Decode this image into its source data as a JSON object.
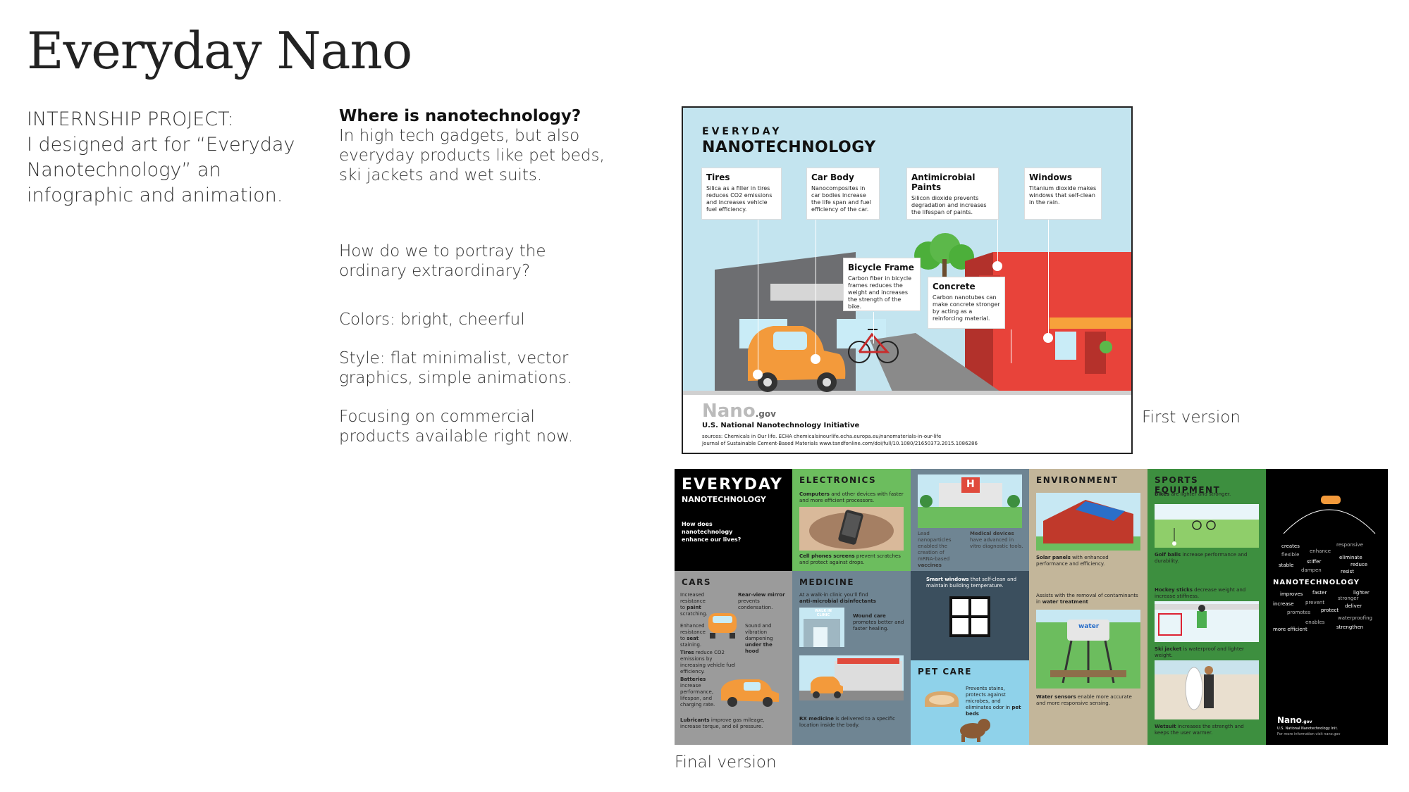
{
  "page_title": "Everyday Nano",
  "intro": {
    "line1": "INTERNSHIP PROJECT:",
    "line2": "I designed art for “Everyday",
    "line3": "Nanotechnology” an",
    "line4": "infographic and animation."
  },
  "notes": {
    "q_title": "Where is nanotechnology?",
    "q_line1": "In high tech gadgets, but also",
    "q_line2": "everyday products like pet beds,",
    "q_line3": "ski jackets and wet suits.",
    "portray_line1": "How do we to portray the",
    "portray_line2": "ordinary extraordinary?",
    "colors": "Colors: bright, cheerful",
    "style_line1": "Style: flat minimalist, vector",
    "style_line2": "graphics, simple animations.",
    "focus_line1": "Focusing on commercial",
    "focus_line2": "products available right now."
  },
  "captions": {
    "first": "First version",
    "final": "Final version"
  },
  "colors": {
    "sky": "#c3e4ef",
    "car_orange": "#f39a3b",
    "building_red": "#e8433a",
    "building_gray": "#6d6e71",
    "electronics_green": "#6cbd5e",
    "medicine_slate": "#6f8593",
    "environment_tan": "#c3b69a",
    "sports_green": "#3d8f3f",
    "pet_blue": "#8fd2ea",
    "cars_gray": "#9b9b9b"
  },
  "v1": {
    "header_small": "EVERYDAY",
    "header_big": "NANOTECHNOLOGY",
    "callouts": {
      "tires": {
        "title": "Tires",
        "desc": "Silica as a filler in tires reduces CO2 emissions and increases vehicle fuel efficiency."
      },
      "carbody": {
        "title": "Car Body",
        "desc": "Nanocomposites in car bodies increase the life span and fuel efficiency of the car."
      },
      "paints": {
        "title": "Antimicrobial Paints",
        "desc": "Silicon dioxide prevents degradation and increases the lifespan of paints."
      },
      "windows": {
        "title": "Windows",
        "desc": "Titanium dioxide makes windows that self-clean in the rain."
      },
      "bicycle": {
        "title": "Bicycle Frame",
        "desc": "Carbon fiber in bicycle frames reduces the weight and increases the strength of the bike."
      },
      "concrete": {
        "title": "Concrete",
        "desc": "Carbon nanotubes can make concrete stronger by acting as a reinforcing material."
      }
    },
    "logo": "Nano",
    "logo_suffix": ".gov",
    "nnis": "U.S. National Nanotechnology Initiative",
    "source1": "sources: Chemicals in Our life. ECHA chemicalsinourlife.echa.europa.eu/nanomaterials-in-our-life",
    "source2": "Journal of Sustainable Cement-Based Materials www.tandfonline.com/doi/full/10.1080/21650373.2015.1086286"
  },
  "v2": {
    "title_small": "EVERYDAY",
    "title_big": "NANOTECHNOLOGY",
    "question": "How does nanotechnology enhance our lives?",
    "electronics": {
      "title": "ELECTRONICS",
      "t1": "Computers",
      "t1b": "and other devices with faster and more efficient processors.",
      "t2": "Cell phones screens",
      "t2b": "prevent scratches and protect against drops."
    },
    "hospital": {
      "t1": "Lead nanoparticles enabled the creation of mRNA-based",
      "t1b": "vaccines",
      "t2": "Medical devices",
      "t2b": "have advanced in vitro diagnostic tools.",
      "sign": "H"
    },
    "environment": {
      "title": "ENVIRONMENT",
      "t1": "Solar panels",
      "t1b": "with enhanced performance and efficiency.",
      "t2": "Assists with the removal of contaminants in",
      "t2b": "water treatment",
      "t3": "Water sensors",
      "t3b": "enable more accurate and more responsive sensing.",
      "tower": "water"
    },
    "sports": {
      "title": "SPORTS EQUIPMENT",
      "t1": "Bikes",
      "t1b": "are lighter and stronger.",
      "t2": "Golf balls",
      "t2b": "increase performance and durability.",
      "t3": "Hockey sticks",
      "t3b": "decrease weight and increase stiffness.",
      "t4": "Ski jacket",
      "t4b": "is waterproof and lighter weight.",
      "t5": "Wetsuit",
      "t5b": "increases the strength and keeps the user warmer."
    },
    "cars": {
      "title": "CARS",
      "t1": "Increased resistance to",
      "t1b": "paint",
      "t1c": "scratching.",
      "t2": "Rear-view mirror",
      "t2b": "prevents condensation.",
      "t3": "Enhanced resistance to",
      "t3b": "seat",
      "t3c": "staining.",
      "t4": "Sound and vibration dampening",
      "t4b": "under the hood",
      "t5": "Tires",
      "t5b": "reduce CO2 emissions by increasing vehicle fuel efficiency.",
      "t6": "Batteries",
      "t6b": "increase performance, lifespan, and charging rate.",
      "t7": "Lubricants",
      "t7b": "improve gas mileage, increase torque, and oil pressure."
    },
    "medicine": {
      "title": "MEDICINE",
      "t1": "At a walk-in clinic you'll find",
      "t1b": "anti-microbial disinfectants",
      "t2": "Wound care",
      "t2b": "promotes better and faster healing.",
      "t3": "RX medicine",
      "t3b": "is delivered to a specific location inside the body.",
      "clinic": "WALK IN CLINIC"
    },
    "windows": {
      "t1": "Smart windows",
      "t1b": "that self-clean and maintain building temperature."
    },
    "petcare": {
      "title": "PET CARE",
      "t1": "Prevents stains, protects against microbes, and eliminates odor in",
      "t1b": "pet beds"
    },
    "words": {
      "creates": "creates",
      "responsive": "responsive",
      "flexible": "flexible",
      "enhance": "enhance",
      "eliminate": "eliminate",
      "stable": "stable",
      "stiffer": "stiffer",
      "reduce": "reduce",
      "dampen": "dampen",
      "resist": "resist",
      "nanotechnology": "NANOTECHNOLOGY",
      "improves": "improves",
      "faster": "faster",
      "lighter": "lighter",
      "stronger": "stronger",
      "increase": "increase",
      "prevent": "prevent",
      "deliver": "deliver",
      "promotes": "promotes",
      "protect": "protect",
      "waterproofing": "waterproofing",
      "enables": "enables",
      "more_efficient": "more efficient",
      "strengthen": "strengthen"
    },
    "logo": "Nano",
    "logo_suffix": ".gov",
    "nnis": "U.S. National Nanotechnology Init.",
    "visit": "For more information visit nano.gov"
  }
}
